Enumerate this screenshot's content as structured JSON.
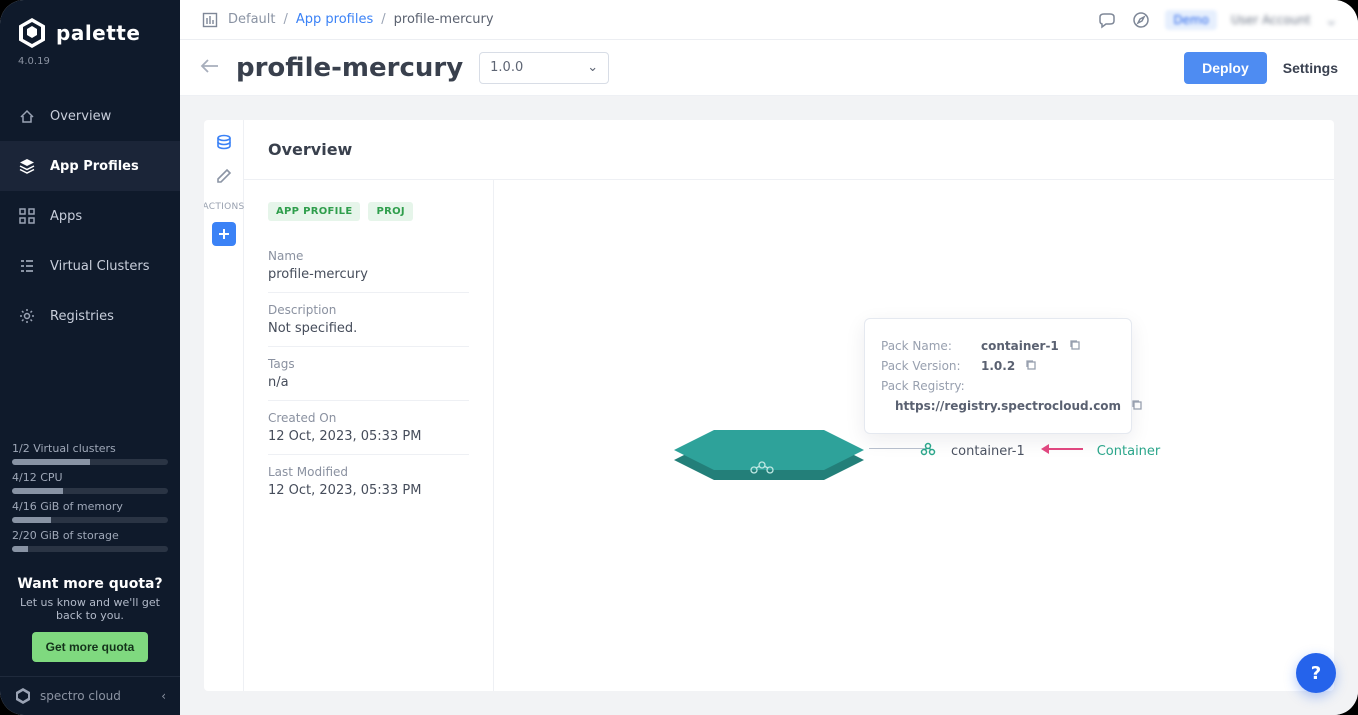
{
  "brand": {
    "name": "palette",
    "version": "4.0.19"
  },
  "sidebar": {
    "items": [
      {
        "label": "Overview"
      },
      {
        "label": "App Profiles"
      },
      {
        "label": "Apps"
      },
      {
        "label": "Virtual Clusters"
      },
      {
        "label": "Registries"
      }
    ],
    "quota": [
      {
        "label": "1/2 Virtual clusters",
        "pct": 50
      },
      {
        "label": "4/12 CPU",
        "pct": 33
      },
      {
        "label": "4/16 GiB of memory",
        "pct": 25
      },
      {
        "label": "2/20 GiB of storage",
        "pct": 10
      }
    ],
    "promo": {
      "title": "Want more quota?",
      "text": "Let us know and we'll get back to you.",
      "cta": "Get more quota"
    },
    "footer": "spectro cloud"
  },
  "topbar": {
    "project_icon_label": "Default",
    "crumbs": {
      "link": "App profiles",
      "current": "profile-mercury"
    },
    "user": {
      "badge": "Demo",
      "name": "User Account"
    }
  },
  "page": {
    "title": "profile-mercury",
    "version": "1.0.0",
    "deploy": "Deploy",
    "settings": "Settings"
  },
  "rail": {
    "actions_label": "ACTIONS"
  },
  "overview": {
    "heading": "Overview",
    "tags": [
      "APP PROFILE",
      "PROJ"
    ],
    "fields": {
      "name": {
        "label": "Name",
        "value": "profile-mercury"
      },
      "description": {
        "label": "Description",
        "value": "Not specified."
      },
      "tags": {
        "label": "Tags",
        "value": "n/a"
      },
      "created": {
        "label": "Created On",
        "value": "12 Oct, 2023, 05:33 PM"
      },
      "modified": {
        "label": "Last Modified",
        "value": "12 Oct, 2023, 05:33 PM"
      }
    }
  },
  "tooltip": {
    "pack_name": {
      "label": "Pack Name:",
      "value": "container-1"
    },
    "pack_version": {
      "label": "Pack Version:",
      "value": "1.0.2"
    },
    "pack_registry": {
      "label": "Pack Registry:",
      "value": "https://registry.spectrocloud.com"
    }
  },
  "layer": {
    "name": "container-1",
    "type": "Container"
  },
  "help": "?"
}
